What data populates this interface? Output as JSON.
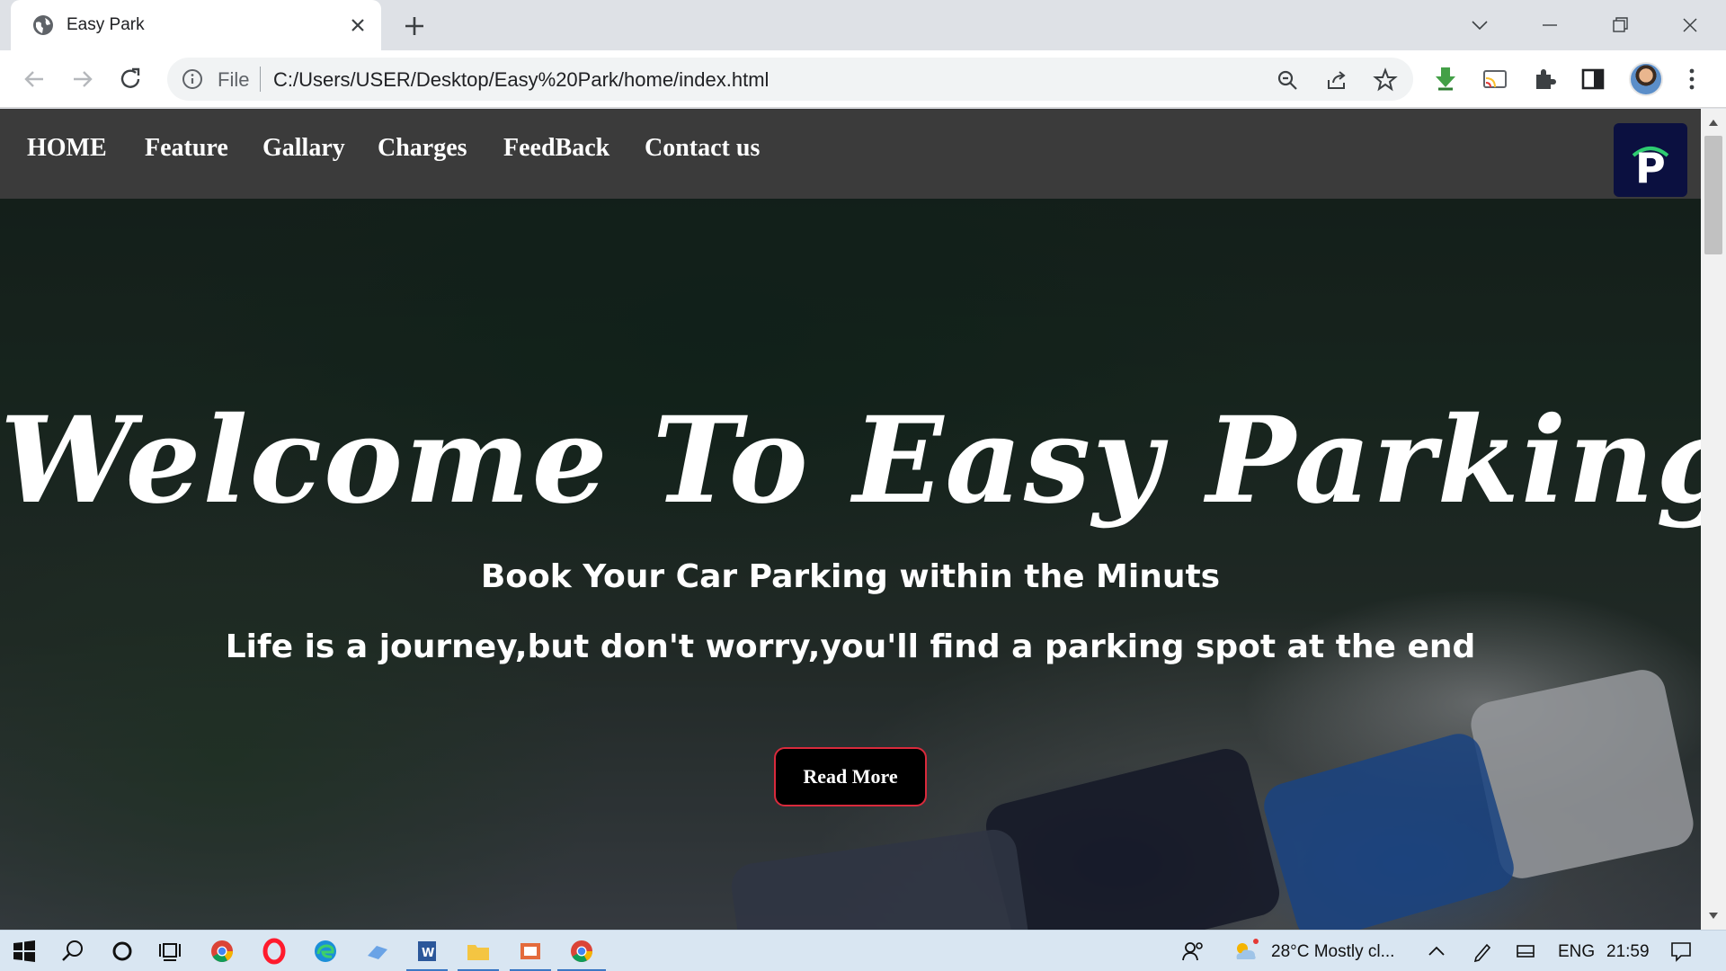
{
  "browser": {
    "tab_title": "Easy Park",
    "omnibox_scheme": "File",
    "url": "C:/Users/USER/Desktop/Easy%20Park/home/index.html"
  },
  "page": {
    "nav": [
      "HOME",
      "Feature",
      "Gallary",
      "Charges",
      "FeedBack",
      "Contact us"
    ],
    "logo_letter": "P",
    "hero_title": "Welcome To Easy Parking",
    "hero_subtitle": "Book Your Car Parking within the Minuts",
    "hero_quote": "Life is a journey,but don't worry,you'll find a parking spot at the end",
    "read_more": "Read More"
  },
  "taskbar": {
    "weather": "28°C  Mostly cl...",
    "language": "ENG",
    "time": "21:59"
  },
  "colors": {
    "navbar": "#3b3b3b",
    "logo_bg": "#0b1040",
    "button_border": "#d92a3c",
    "taskbar": "#d9e6f2"
  },
  "icons": [
    "globe-icon",
    "close-icon",
    "plus-icon",
    "back-icon",
    "forward-icon",
    "reload-icon",
    "info-icon",
    "zoom-icon",
    "share-icon",
    "star-icon",
    "download-icon",
    "cast-icon",
    "extensions-icon",
    "sidebar-icon",
    "menu-icon",
    "windows-icon",
    "search-icon",
    "cortana-icon",
    "task-view-icon",
    "chrome-icon",
    "opera-icon",
    "edge-icon",
    "word-icon",
    "folder-icon",
    "weather-icon",
    "notification-icon"
  ]
}
